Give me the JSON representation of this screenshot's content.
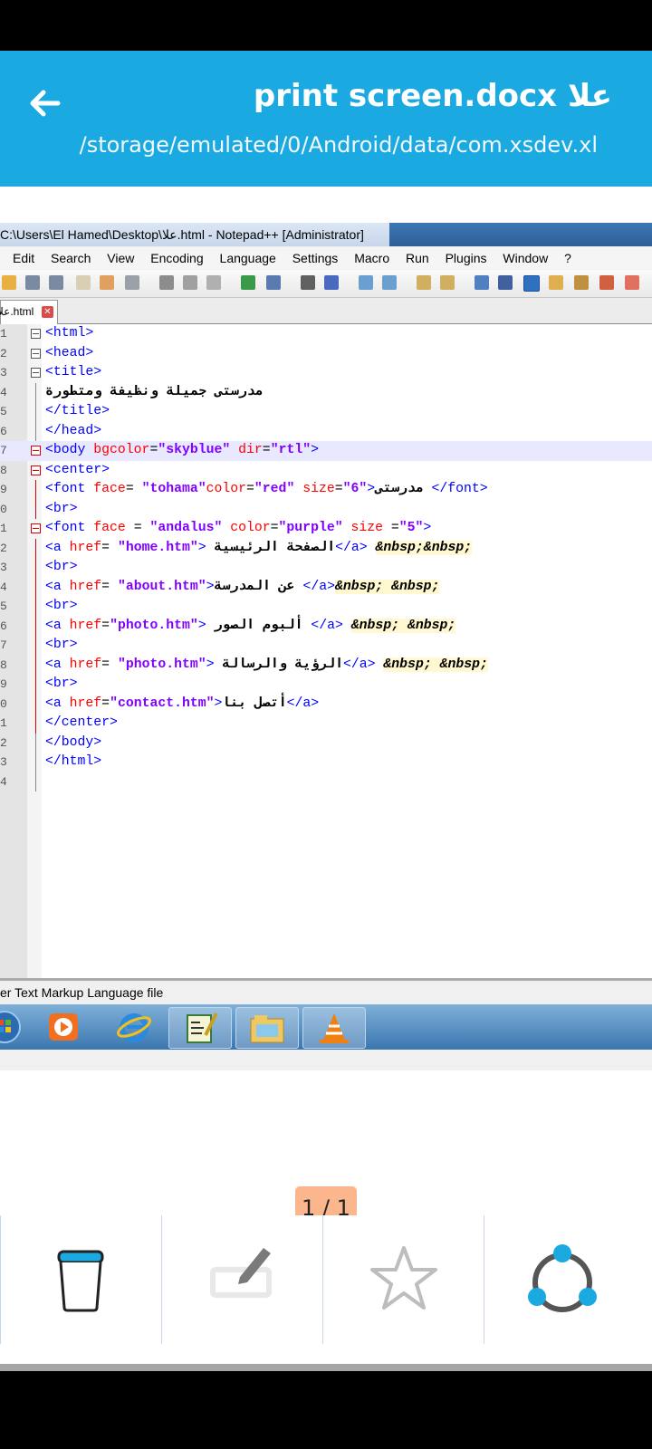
{
  "header": {
    "title": "print screen.docx علا",
    "path": "/storage/emulated/0/Android/data/com.xsdev.xl"
  },
  "screenshot": {
    "window_title": "C:\\Users\\El Hamed\\Desktop\\علا.html - Notepad++ [Administrator]",
    "menu": [
      "Edit",
      "Search",
      "View",
      "Encoding",
      "Language",
      "Settings",
      "Macro",
      "Run",
      "Plugins",
      "Window",
      "?"
    ],
    "tab_label": "علا.html",
    "status_text": "er Text Markup Language file",
    "line_numbers": [
      "1",
      "2",
      "3",
      "4",
      "5",
      "6",
      "7",
      "8",
      "9",
      "0",
      "1",
      "2",
      "3",
      "4",
      "5",
      "6",
      "7",
      "8",
      "9",
      "0",
      "1",
      "2",
      "3",
      "4"
    ],
    "code": {
      "l1": "<html>",
      "l2": "<head>",
      "l3": "<title>",
      "l4": "مدرستى جميلة ونظيفة ومتطورة",
      "l5": "</title>",
      "l6": "</head>",
      "l7_tag": "<body ",
      "l7_a1": "bgcolor",
      "l7_eq1": "=",
      "l7_v1": "\"skyblue\"",
      "l7_a2": " dir",
      "l7_eq2": "=",
      "l7_v2": "\"rtl\"",
      "l7_end": ">",
      "l8": "<center>",
      "l9_tag": "<font ",
      "l9_a1": "face",
      "l9_eq1": "= ",
      "l9_v1": "\"tohama\"",
      "l9_a2": "color",
      "l9_eq2": "=",
      "l9_v2": "\"red\"",
      "l9_a3": " size",
      "l9_eq3": "=",
      "l9_v3": "\"6\"",
      "l9_gt": ">",
      "l9_text": "مدرستى ",
      "l9_close": "</font>",
      "l10": "<br>",
      "l11_tag": "<font ",
      "l11_a1": "face",
      "l11_eq1": " = ",
      "l11_v1": "\"andalus\"",
      "l11_a2": " color",
      "l11_eq2": "=",
      "l11_v2": "\"purple\"",
      "l11_a3": " size",
      "l11_eq3": " =",
      "l11_v3": "\"5\"",
      "l11_gt": ">",
      "l12_tag": "<a ",
      "l12_a": "href",
      "l12_eq": "= ",
      "l12_v": "\"home.htm\"",
      "l12_gt": "> ",
      "l12_text": "الصفحة الرئيسية",
      "l12_close": "</a>",
      "l12_ent": "&nbsp;&nbsp;",
      "l13": "<br>",
      "l14_tag": "<a ",
      "l14_a": "href",
      "l14_eq": "= ",
      "l14_v": "\"about.htm\"",
      "l14_gt": ">",
      "l14_text": "عن المدرسة ",
      "l14_close": "</a>",
      "l14_ent": "&nbsp; &nbsp;",
      "l15": "<br>",
      "l16_tag": "<a ",
      "l16_a": "href",
      "l16_eq": "=",
      "l16_v": "\"photo.htm\"",
      "l16_gt": "> ",
      "l16_text": "ألبوم الصور ",
      "l16_close": "</a>",
      "l16_ent": "&nbsp; &nbsp;",
      "l17": "<br>",
      "l18_tag": "<a ",
      "l18_a": "href",
      "l18_eq": "= ",
      "l18_v": "\"photo.htm\"",
      "l18_gt": "> ",
      "l18_text": "الرؤية والرسالة",
      "l18_close": "</a>",
      "l18_ent": "&nbsp; &nbsp;",
      "l19": "<br>",
      "l20_tag": "<a ",
      "l20_a": "href",
      "l20_eq": "=",
      "l20_v": "\"contact.htm\"",
      "l20_gt": ">",
      "l20_text": "أتصل بنا",
      "l20_close": "</a>",
      "l21": "</center>",
      "l22": "</body>",
      "l23": "</html>"
    }
  },
  "pager": "1 / 1",
  "colors": {
    "header_bg": "#1aa9e1",
    "pager_bg": "#fbb68e",
    "share_icon": "#1aa9e1"
  },
  "bottom_icons": [
    "trash-icon",
    "edit-icon",
    "star-icon",
    "share-icon"
  ]
}
